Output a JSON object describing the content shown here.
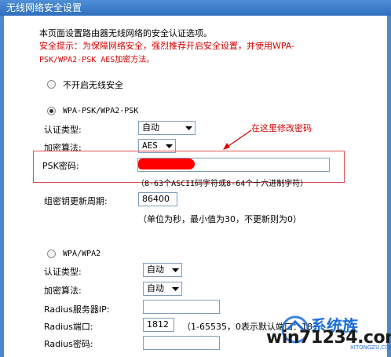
{
  "window": {
    "title": "无线网络安全设置"
  },
  "intro": {
    "line1": "本页面设置路由器无线网络的安全认证选项。",
    "line2": "安全提示：为保障网络安全，强烈推荐开启安全设置，并使用WPA-",
    "line3": "PSK/WPA2-PSK AES加密方法。"
  },
  "no_security": {
    "label": "不开启无线安全",
    "selected": false
  },
  "wpa_psk": {
    "label": "WPA-PSK/WPA2-PSK",
    "selected": true,
    "auth_label": "认证类型:",
    "auth_value": "自动",
    "enc_label": "加密算法:",
    "enc_value": "AES",
    "psk_label": "PSK密码:",
    "psk_hint": "（8-63个ASCII码字符或8-64个十六进制字符）",
    "renew_label": "组密钥更新周期:",
    "renew_value": "86400",
    "renew_hint": "（单位为秒，最小值为30，不更新则为0）"
  },
  "annotation": {
    "text": "在这里修改密码",
    "color": "#e00000"
  },
  "wpa": {
    "label": "WPA/WPA2",
    "selected": false,
    "auth_label": "认证类型:",
    "auth_value": "自动",
    "enc_label": "加密算法:",
    "enc_value": "自动",
    "radius_ip_label": "Radius服务器IP:",
    "radius_ip_value": "",
    "radius_port_label": "Radius端口:",
    "radius_port_value": "1812",
    "radius_port_hint": "（1-65535，0表示默认端口：18",
    "radius_pwd_label": "Radius密码:"
  },
  "watermark": {
    "brand": "win71234.com",
    "cn": "系统族",
    "small": "XITONGZU.COM"
  },
  "colors": {
    "titlebar": "#3b7ccc",
    "warning": "#d40000",
    "annotation": "#e00000"
  }
}
